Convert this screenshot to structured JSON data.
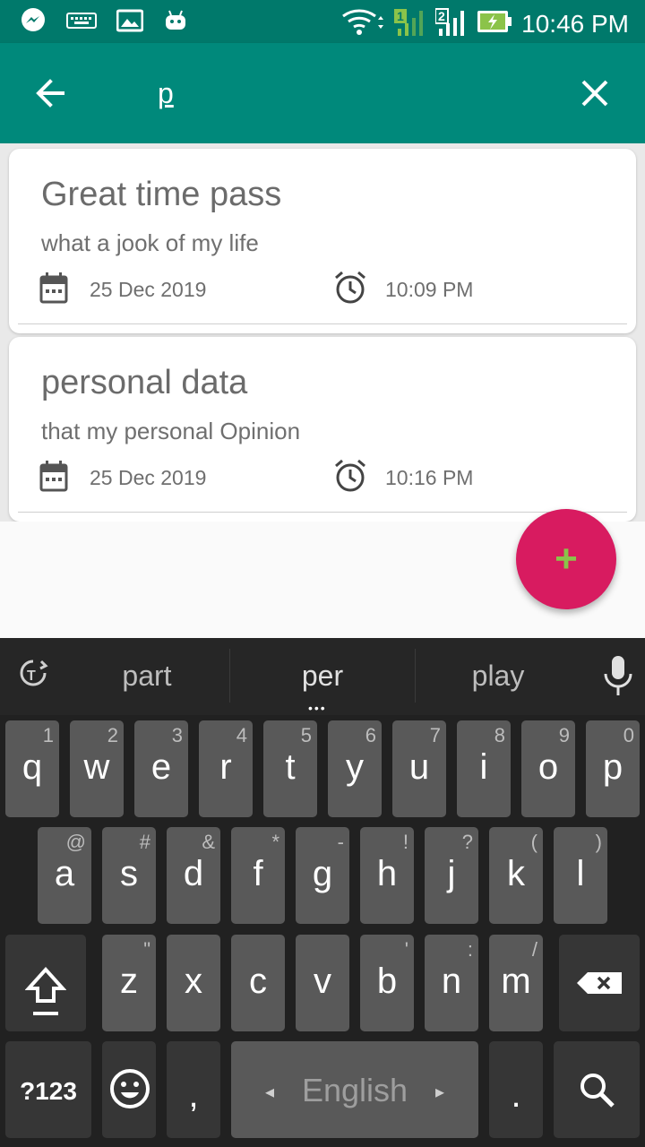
{
  "status_bar": {
    "time": "10:46 PM",
    "icons": [
      "messenger-icon",
      "keyboard-icon",
      "image-icon",
      "android-icon",
      "wifi-icon",
      "signal-sim1-icon",
      "signal-sim2-icon",
      "battery-charging-icon"
    ],
    "sim1_label": "1",
    "sim2_label": "2"
  },
  "app_bar": {
    "back_icon": "arrow-left-icon",
    "search_query": "p",
    "close_icon": "close-icon"
  },
  "notes": [
    {
      "title": "Great time pass",
      "description": "what a jook of my life",
      "date": "25 Dec 2019",
      "time": "10:09 PM"
    },
    {
      "title": "personal data",
      "description": "that my personal Opinion",
      "date": "25 Dec 2019",
      "time": "10:16 PM"
    }
  ],
  "fab": {
    "icon": "plus-icon",
    "label": "+",
    "color": "#d81b60",
    "icon_color": "#8bc34a"
  },
  "keyboard": {
    "suggestions": [
      "part",
      "per",
      "play"
    ],
    "suggestion_more": "•••",
    "row1": [
      {
        "key": "q",
        "hint": "1"
      },
      {
        "key": "w",
        "hint": "2"
      },
      {
        "key": "e",
        "hint": "3"
      },
      {
        "key": "r",
        "hint": "4"
      },
      {
        "key": "t",
        "hint": "5"
      },
      {
        "key": "y",
        "hint": "6"
      },
      {
        "key": "u",
        "hint": "7"
      },
      {
        "key": "i",
        "hint": "8"
      },
      {
        "key": "o",
        "hint": "9"
      },
      {
        "key": "p",
        "hint": "0"
      }
    ],
    "row2": [
      {
        "key": "a",
        "hint": "@"
      },
      {
        "key": "s",
        "hint": "#"
      },
      {
        "key": "d",
        "hint": "&"
      },
      {
        "key": "f",
        "hint": "*"
      },
      {
        "key": "g",
        "hint": "-"
      },
      {
        "key": "h",
        "hint": "!"
      },
      {
        "key": "j",
        "hint": "?"
      },
      {
        "key": "k",
        "hint": "("
      },
      {
        "key": "l",
        "hint": ")"
      }
    ],
    "row3": [
      {
        "key": "z",
        "hint": "\""
      },
      {
        "key": "x",
        "hint": ""
      },
      {
        "key": "c",
        "hint": ""
      },
      {
        "key": "v",
        "hint": ""
      },
      {
        "key": "b",
        "hint": "'"
      },
      {
        "key": "n",
        "hint": ":"
      },
      {
        "key": "m",
        "hint": "/"
      }
    ],
    "symbols_label": "?123",
    "comma": ",",
    "period": ".",
    "space_label": "English",
    "space_arrow_left": "◂",
    "space_arrow_right": "▸"
  },
  "colors": {
    "status_bar": "#00796b",
    "app_bar": "#00897b",
    "keyboard_bg": "#212121",
    "key_bg": "#595959"
  }
}
